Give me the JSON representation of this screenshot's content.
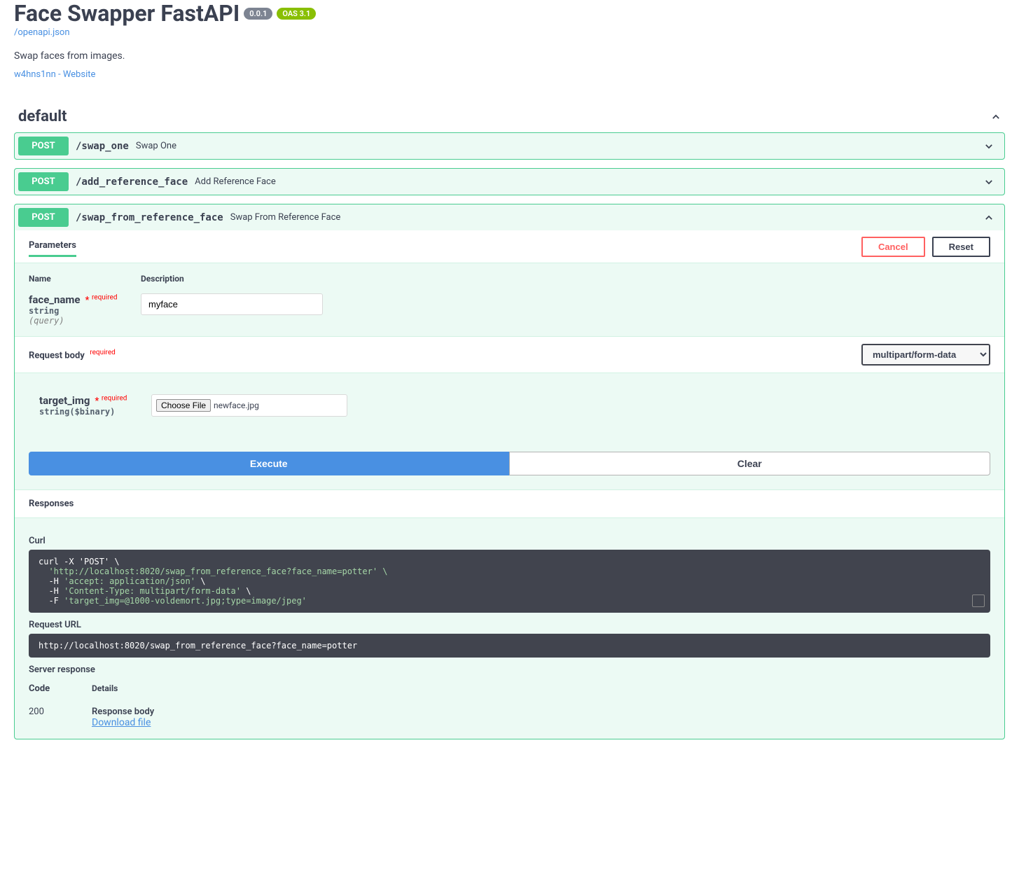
{
  "header": {
    "title": "Face Swapper FastAPI",
    "version_badge": "0.0.1",
    "oas_badge": "OAS 3.1",
    "openapi_link": "/openapi.json",
    "description": "Swap faces from images.",
    "author_link": "w4hns1nn - Website"
  },
  "section": {
    "name": "default"
  },
  "ops": [
    {
      "method": "POST",
      "path": "/swap_one",
      "summary": "Swap One"
    },
    {
      "method": "POST",
      "path": "/add_reference_face",
      "summary": "Add Reference Face"
    },
    {
      "method": "POST",
      "path": "/swap_from_reference_face",
      "summary": "Swap From Reference Face"
    }
  ],
  "detail": {
    "tab_parameters": "Parameters",
    "cancel": "Cancel",
    "reset": "Reset",
    "name_header": "Name",
    "desc_header": "Description",
    "required_label": "required",
    "param": {
      "name": "face_name",
      "type": "string",
      "in": "(query)",
      "value": "myface"
    },
    "request_body_label": "Request body",
    "content_type": "multipart/form-data",
    "body_param": {
      "name": "target_img",
      "type": "string($binary)",
      "choose_file": "Choose File",
      "filename": "newface.jpg"
    },
    "execute": "Execute",
    "clear": "Clear",
    "responses_label": "Responses"
  },
  "response": {
    "curl_label": "Curl",
    "curl_cmd": "curl -X 'POST' \\",
    "curl_url": "  'http://localhost:8020/swap_from_reference_face?face_name=potter' \\",
    "curl_h1_pre": "  -H ",
    "curl_h1": "'accept: application/json'",
    "curl_h1_post": " \\",
    "curl_h2_pre": "  -H ",
    "curl_h2": "'Content-Type: multipart/form-data'",
    "curl_h2_post": " \\",
    "curl_f_pre": "  -F ",
    "curl_f": "'target_img=@1000-voldemort.jpg;type=image/jpeg'",
    "request_url_label": "Request URL",
    "request_url": "http://localhost:8020/swap_from_reference_face?face_name=potter",
    "server_response_label": "Server response",
    "code_header": "Code",
    "details_header": "Details",
    "status_code": "200",
    "response_body_label": "Response body",
    "download_file": "Download file"
  }
}
